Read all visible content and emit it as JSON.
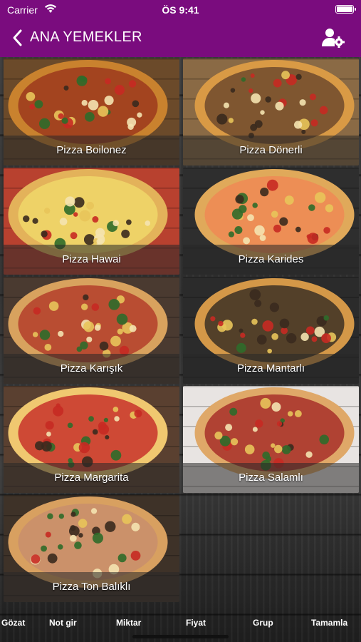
{
  "status_bar": {
    "carrier": "Carrier",
    "time": "ÖS 9:41"
  },
  "header": {
    "title": "ANA YEMEKLER",
    "color": "#7a0c7e"
  },
  "products": [
    {
      "name": "Pizza Boilonez",
      "crust": "#c9822e",
      "topping": "#9c3a1c",
      "board": "#6b4a2a"
    },
    {
      "name": "Pizza Dönerli",
      "crust": "#d99a45",
      "topping": "#6e4a2d",
      "board": "#8a6a45"
    },
    {
      "name": "Pizza Hawai",
      "crust": "#e3b25a",
      "topping": "#f0d76a",
      "board": "#b8412f"
    },
    {
      "name": "Pizza Karides",
      "crust": "#e0a95a",
      "topping": "#ee8a55",
      "board": "#2e2e2e"
    },
    {
      "name": "Pizza Karışık",
      "crust": "#d8a25e",
      "topping": "#b43e2a",
      "board": "#4a3a30"
    },
    {
      "name": "Pizza Mantarlı",
      "crust": "#d49848",
      "topping": "#3c3025",
      "board": "#2b2b2b"
    },
    {
      "name": "Pizza Margarita",
      "crust": "#f0c870",
      "topping": "#c8332a",
      "board": "#5a4030"
    },
    {
      "name": "Pizza Salamlı",
      "crust": "#dfa868",
      "topping": "#a8302a",
      "board": "#e8e4e2"
    },
    {
      "name": "Pizza Ton Balıklı",
      "crust": "#d8a060",
      "topping": "#c98e6c",
      "board": "#3e3228"
    }
  ],
  "toolbar": {
    "items": [
      "Gözat",
      "Not gir",
      "Miktar",
      "Fiyat",
      "Grup",
      "Tamamla"
    ]
  },
  "icons": {
    "back": "chevron-left-icon",
    "user_settings": "user-settings-icon",
    "wifi": "wifi-icon",
    "battery": "battery-icon"
  }
}
